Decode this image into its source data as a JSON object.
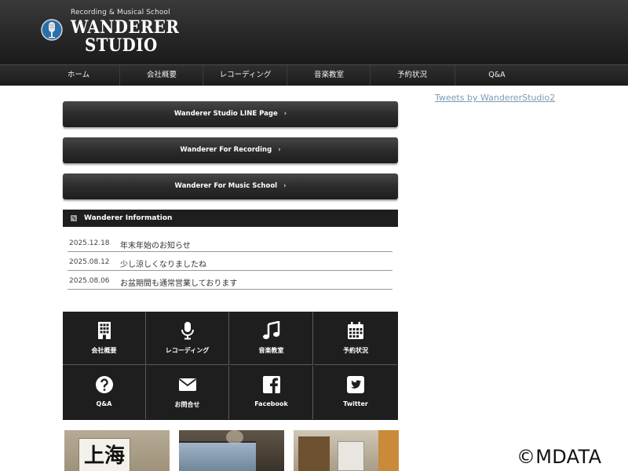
{
  "header": {
    "tagline": "Recording & Musical School",
    "logo_line1": "WANDERER",
    "logo_line2": "STUDIO"
  },
  "nav": {
    "items": [
      "ホーム",
      "会社概要",
      "レコーディング",
      "音楽教室",
      "予約状況",
      "Q&A"
    ]
  },
  "sidebar": {
    "tweets_link": "Tweets by WandererStudio2"
  },
  "buttons": [
    {
      "label": "Wanderer Studio LINE Page"
    },
    {
      "label": "Wanderer For Recording"
    },
    {
      "label": "Wanderer For Music School"
    }
  ],
  "chevron": "›",
  "info": {
    "title": "Wanderer Information",
    "news": [
      {
        "date": "2025.12.18",
        "text": "年末年始のお知らせ"
      },
      {
        "date": "2025.08.12",
        "text": "少し涼しくなりましたね"
      },
      {
        "date": "2025.08.06",
        "text": "お盆期間も通常営業しております"
      }
    ]
  },
  "grid": [
    {
      "label": "会社概要",
      "icon": "building-icon"
    },
    {
      "label": "レコーディング",
      "icon": "microphone-icon"
    },
    {
      "label": "音楽教室",
      "icon": "music-note-icon"
    },
    {
      "label": "予約状況",
      "icon": "calendar-icon"
    },
    {
      "label": "Q&A",
      "icon": "question-icon"
    },
    {
      "label": "お問合せ",
      "icon": "envelope-icon"
    },
    {
      "label": "Facebook",
      "icon": "facebook-icon"
    },
    {
      "label": "Twitter",
      "icon": "twitter-icon"
    }
  ],
  "photos": {
    "photo1_sign": "上海"
  },
  "watermark": "©MDATA",
  "colors": {
    "header_bg": "#262626",
    "button_bg": "#2c2c2c",
    "link": "#7b9bb8"
  }
}
